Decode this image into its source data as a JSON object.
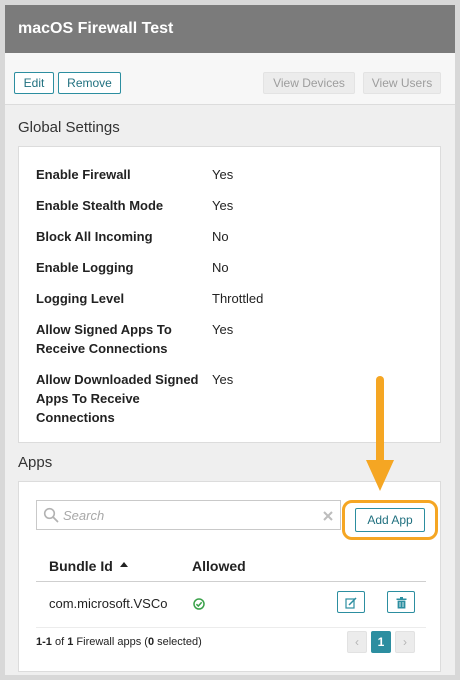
{
  "window": {
    "title": "macOS Firewall Test"
  },
  "toolbar": {
    "edit_label": "Edit",
    "remove_label": "Remove",
    "view_devices_label": "View Devices",
    "view_users_label": "View Users"
  },
  "global_settings": {
    "title": "Global Settings",
    "rows": [
      {
        "label": "Enable Firewall",
        "value": "Yes"
      },
      {
        "label": "Enable Stealth Mode",
        "value": "Yes"
      },
      {
        "label": "Block All Incoming",
        "value": "No"
      },
      {
        "label": "Enable Logging",
        "value": "No"
      },
      {
        "label": "Logging Level",
        "value": "Throttled"
      },
      {
        "label": "Allow Signed Apps To Receive Connections",
        "value": "Yes"
      },
      {
        "label": "Allow Downloaded Signed Apps To Receive Connections",
        "value": "Yes"
      }
    ]
  },
  "apps": {
    "title": "Apps",
    "search": {
      "placeholder": "Search",
      "value": ""
    },
    "add_app_label": "Add App",
    "table": {
      "columns": [
        {
          "label": "Bundle Id",
          "sort": "ascending"
        },
        {
          "label": "Allowed"
        }
      ],
      "rows": [
        {
          "bundle_id": "com.microsoft.VSCo",
          "allowed": true
        }
      ]
    },
    "footer": {
      "range": "1-1",
      "of": "of",
      "total": "1",
      "text": "Firewall apps (",
      "selected": "0",
      "selected_suffix": "selected)"
    },
    "pagination": {
      "current_page": "1",
      "prev_symbol": "‹",
      "next_symbol": "›"
    }
  },
  "colors": {
    "accent": "#2c8ea0",
    "annotation": "#f5a623",
    "titlebar": "#7b7b7b",
    "allowed": "#3aa14a"
  }
}
